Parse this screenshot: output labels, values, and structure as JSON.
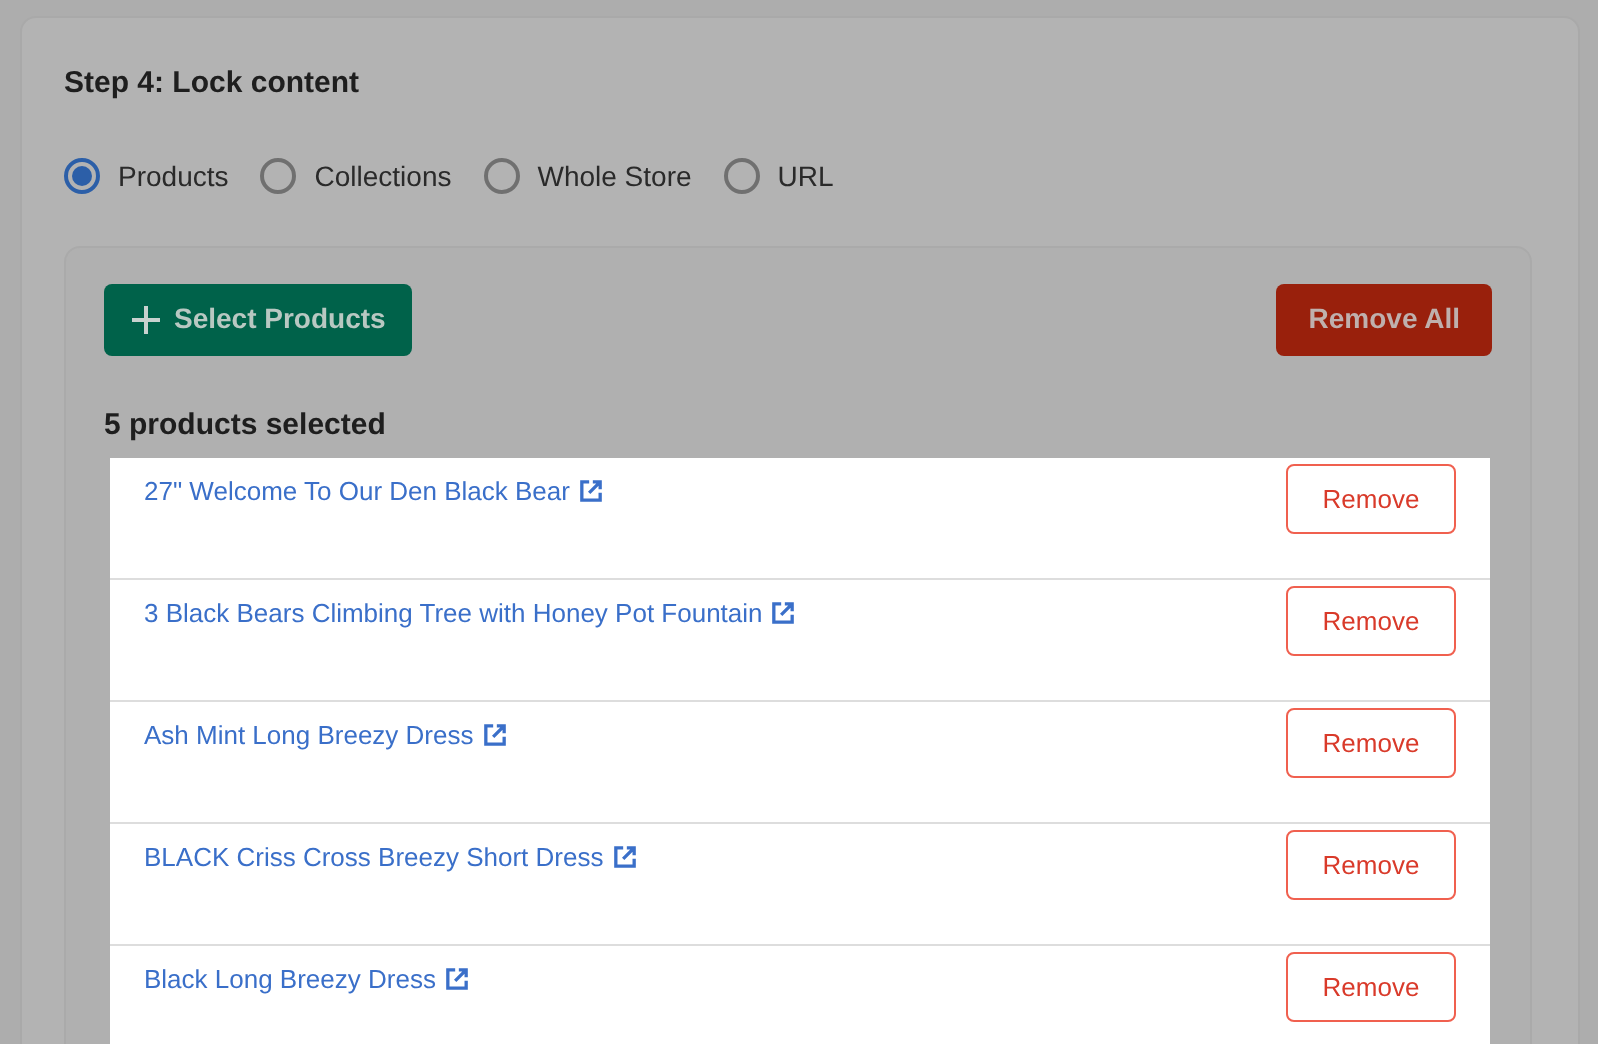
{
  "step_title": "Step 4: Lock content",
  "scope_options": [
    {
      "label": "Products",
      "selected": true
    },
    {
      "label": "Collections",
      "selected": false
    },
    {
      "label": "Whole Store",
      "selected": false
    },
    {
      "label": "URL",
      "selected": false
    }
  ],
  "select_button": "Select Products",
  "remove_all_button": "Remove All",
  "selected_count": "5 products selected",
  "products": [
    {
      "name": "27\" Welcome To Our Den Black Bear",
      "action": "Remove"
    },
    {
      "name": "3 Black Bears Climbing Tree with Honey Pot Fountain",
      "action": "Remove"
    },
    {
      "name": "Ash Mint Long Breezy Dress",
      "action": "Remove"
    },
    {
      "name": "BLACK Criss Cross Breezy Short Dress",
      "action": "Remove"
    },
    {
      "name": "Black Long Breezy Dress",
      "action": "Remove"
    }
  ]
}
